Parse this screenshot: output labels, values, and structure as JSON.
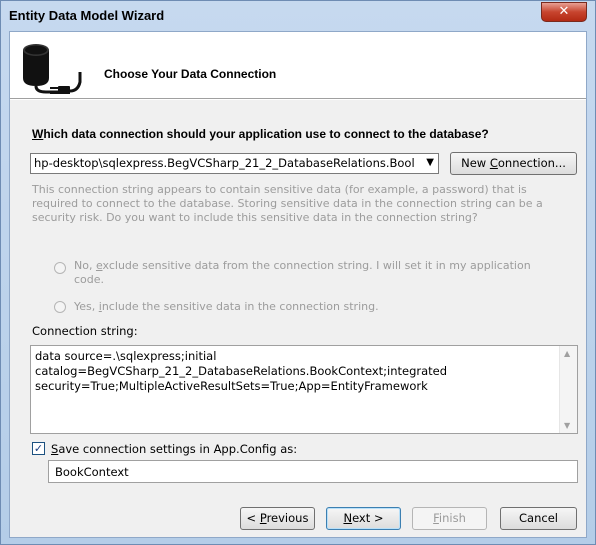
{
  "window": {
    "title": "Entity Data Model Wizard",
    "close_glyph": "✕"
  },
  "header": {
    "title": "Choose Your Data Connection"
  },
  "question": {
    "prefix": "W",
    "rest": "hich data connection should your application use to connect to the database?"
  },
  "connection_combo": {
    "value": "hp-desktop\\sqlexpress.BegVCSharp_21_2_DatabaseRelations.Bool",
    "arrow": "▼"
  },
  "new_connection_button": {
    "pre": "New ",
    "key": "C",
    "post": "onnection..."
  },
  "sensitive_warning": "This connection string appears to contain sensitive data (for example, a password) that is required to connect to the database. Storing sensitive data in the connection string can be a security risk. Do you want to include this sensitive data in the connection string?",
  "radio_exclude": {
    "pre": "No, ",
    "key": "e",
    "line1_post": "xclude sensitive data from the connection string. I will set it in my application",
    "line2": "code."
  },
  "radio_include": {
    "pre": "Yes, ",
    "key": "i",
    "post": "nclude the sensitive data in the connection string."
  },
  "connection_string": {
    "label": "Connection string:",
    "value": "data source=.\\sqlexpress;initial\ncatalog=BegVCSharp_21_2_DatabaseRelations.BookContext;integrated\nsecurity=True;MultipleActiveResultSets=True;App=EntityFramework"
  },
  "save_settings": {
    "checked": true,
    "check_glyph": "✓",
    "key": "S",
    "post": "ave connection settings in App.Config as:"
  },
  "config_name": {
    "value": "BookContext"
  },
  "buttons": {
    "previous": {
      "pre": "< ",
      "key": "P",
      "post": "revious"
    },
    "next": {
      "pre": "",
      "key": "N",
      "post": "ext >"
    },
    "finish": {
      "pre": "",
      "key": "F",
      "post": "inish"
    },
    "cancel": {
      "label": "Cancel"
    }
  },
  "colors": {
    "accent": "#3c7fb1",
    "disabled_text": "#9c9c9c"
  }
}
